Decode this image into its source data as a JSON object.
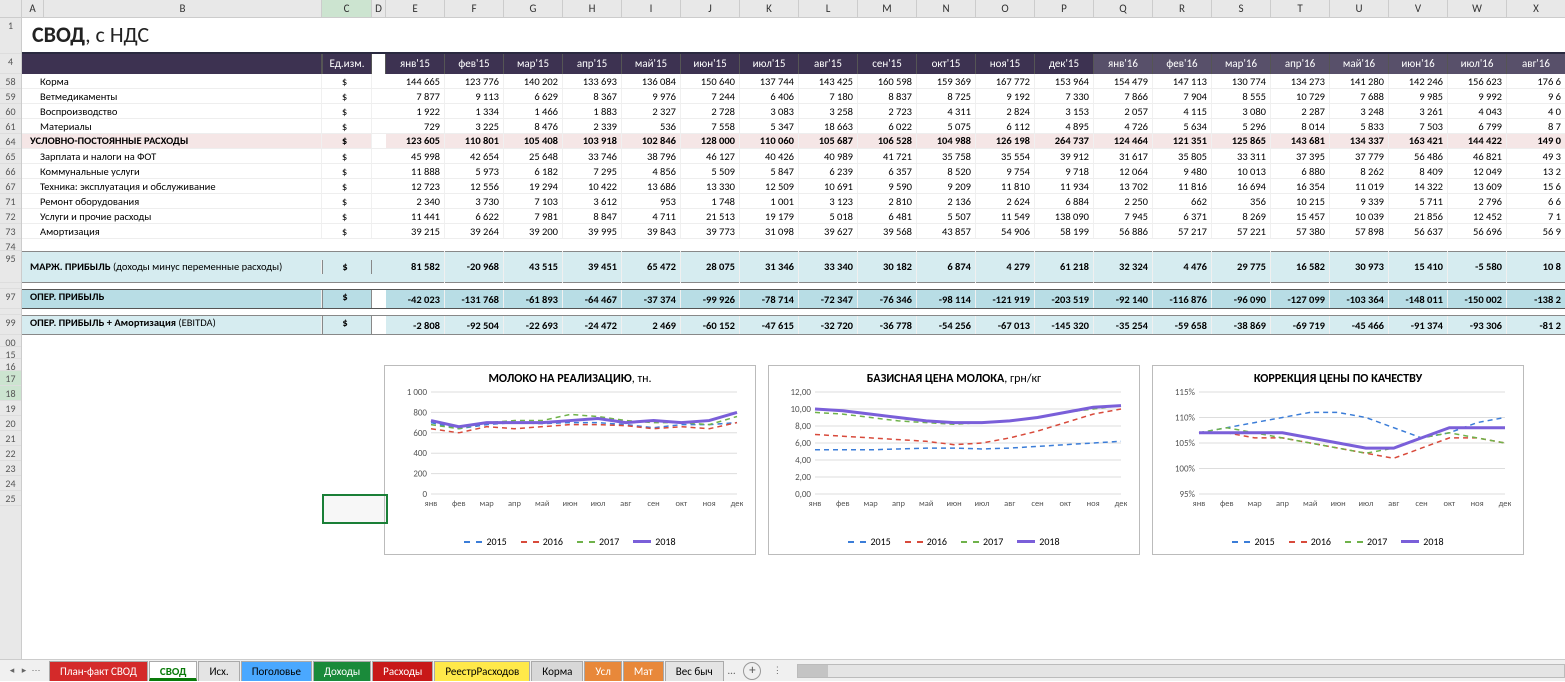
{
  "title": {
    "main": "СВОД",
    "sub": ", с НДС"
  },
  "columns_letters": [
    "A",
    "B",
    "C",
    "D",
    "E",
    "F",
    "G",
    "H",
    "I",
    "J",
    "K",
    "L",
    "M",
    "N",
    "O",
    "P",
    "Q",
    "R",
    "S",
    "T",
    "U",
    "V",
    "W",
    "X"
  ],
  "row_numbers": [
    "1",
    "4",
    "58",
    "59",
    "60",
    "61",
    "64",
    "65",
    "66",
    "67",
    "71",
    "72",
    "73",
    "74",
    "95",
    "97",
    "99",
    "00",
    "15",
    "16",
    "17",
    "18",
    "19",
    "20",
    "21",
    "22",
    "23",
    "24",
    "25"
  ],
  "selected_row_idx": [
    21,
    22
  ],
  "units_header": "Ед.изм.",
  "months": [
    "янв'15",
    "фев'15",
    "мар'15",
    "апр'15",
    "май'15",
    "июн'15",
    "июл'15",
    "авг'15",
    "сен'15",
    "окт'15",
    "ноя'15",
    "дек'15",
    "янв'16",
    "фев'16",
    "мар'16",
    "апр'16",
    "май'16",
    "июн'16",
    "июл'16",
    "авг'16"
  ],
  "rows": [
    {
      "label": "Корма",
      "unit": "$",
      "vals": [
        "144 665",
        "123 776",
        "140 202",
        "133 693",
        "136 084",
        "150 640",
        "137 744",
        "143 425",
        "160 598",
        "159 369",
        "167 772",
        "153 964",
        "154 479",
        "147 113",
        "130 774",
        "134 273",
        "141 280",
        "142 246",
        "156 623",
        "176 6"
      ]
    },
    {
      "label": "Ветмедикаменты",
      "unit": "$",
      "vals": [
        "7 877",
        "9 113",
        "6 629",
        "8 367",
        "9 976",
        "7 244",
        "6 406",
        "7 180",
        "8 837",
        "8 725",
        "9 192",
        "7 330",
        "7 866",
        "7 904",
        "8 555",
        "10 729",
        "7 688",
        "9 985",
        "9 992",
        "9 6"
      ]
    },
    {
      "label": "Воспроизводство",
      "unit": "$",
      "vals": [
        "1 922",
        "1 334",
        "1 466",
        "1 883",
        "2 327",
        "2 728",
        "3 083",
        "3 258",
        "2 723",
        "4 311",
        "2 824",
        "3 153",
        "2 057",
        "4 115",
        "3 080",
        "2 287",
        "3 248",
        "3 261",
        "4 043",
        "4 0"
      ]
    },
    {
      "label": "Материалы",
      "unit": "$",
      "vals": [
        "729",
        "3 225",
        "8 476",
        "2 339",
        "536",
        "7 558",
        "5 347",
        "18 663",
        "6 022",
        "5 075",
        "6 112",
        "4 895",
        "4 726",
        "5 634",
        "5 296",
        "8 014",
        "5 833",
        "7 503",
        "6 799",
        "8 7"
      ]
    },
    {
      "label": "УСЛОВНО-ПОСТОЯННЫЕ РАСХОДЫ",
      "unit": "$",
      "section": true,
      "vals": [
        "123 605",
        "110 801",
        "105 408",
        "103 918",
        "102 846",
        "128 000",
        "110 060",
        "105 687",
        "106 528",
        "104 988",
        "126 198",
        "264 737",
        "124 464",
        "121 351",
        "125 865",
        "143 681",
        "134 337",
        "163 421",
        "144 422",
        "149 0"
      ]
    },
    {
      "label": "Зарплата и налоги на ФОТ",
      "unit": "$",
      "vals": [
        "45 998",
        "42 654",
        "25 648",
        "33 746",
        "38 796",
        "46 127",
        "40 426",
        "40 989",
        "41 721",
        "35 758",
        "35 554",
        "39 912",
        "31 617",
        "35 805",
        "33 311",
        "37 395",
        "37 779",
        "56 486",
        "46 821",
        "49 3"
      ]
    },
    {
      "label": "Коммунальные услуги",
      "unit": "$",
      "vals": [
        "11 888",
        "5 973",
        "6 182",
        "7 295",
        "4 856",
        "5 509",
        "5 847",
        "6 239",
        "6 357",
        "8 520",
        "9 754",
        "9 718",
        "12 064",
        "9 480",
        "10 013",
        "6 880",
        "8 262",
        "8 409",
        "12 049",
        "13 2"
      ]
    },
    {
      "label": "Техника: эксплуатация и обслуживание",
      "unit": "$",
      "vals": [
        "12 723",
        "12 556",
        "19 294",
        "10 422",
        "13 686",
        "13 330",
        "12 509",
        "10 691",
        "9 590",
        "9 209",
        "11 810",
        "11 934",
        "13 702",
        "11 816",
        "16 694",
        "16 354",
        "11 019",
        "14 322",
        "13 609",
        "15 6"
      ]
    },
    {
      "label": "Ремонт оборудования",
      "unit": "$",
      "vals": [
        "2 340",
        "3 730",
        "7 103",
        "3 612",
        "953",
        "1 748",
        "1 001",
        "3 123",
        "2 810",
        "2 136",
        "2 624",
        "6 884",
        "2 250",
        "662",
        "356",
        "10 215",
        "9 339",
        "5 711",
        "2 796",
        "6 6"
      ]
    },
    {
      "label": "Услуги и прочие расходы",
      "unit": "$",
      "vals": [
        "11 441",
        "6 622",
        "7 981",
        "8 847",
        "4 711",
        "21 513",
        "19 179",
        "5 018",
        "6 481",
        "5 507",
        "11 549",
        "138 090",
        "7 945",
        "6 371",
        "8 269",
        "15 457",
        "10 039",
        "21 856",
        "12 452",
        "7 1"
      ]
    },
    {
      "label": "Амортизация",
      "unit": "$",
      "vals": [
        "39 215",
        "39 264",
        "39 200",
        "39 995",
        "39 843",
        "39 773",
        "31 098",
        "39 627",
        "39 568",
        "43 857",
        "54 906",
        "58 199",
        "56 886",
        "57 217",
        "57 221",
        "57 380",
        "57 898",
        "56 637",
        "56 696",
        "56 9"
      ]
    }
  ],
  "bottom_rows": [
    {
      "label": "МАРЖ. ПРИБЫЛЬ",
      "suffix": " (доходы минус переменные расходы)",
      "unit": "$",
      "cls": "blue",
      "tall": true,
      "vals": [
        "81 582",
        "-20 968",
        "43 515",
        "39 451",
        "65 472",
        "28 075",
        "31 346",
        "33 340",
        "30 182",
        "6 874",
        "4 279",
        "61 218",
        "32 324",
        "4 476",
        "29 775",
        "16 582",
        "30 973",
        "15 410",
        "-5 580",
        "10 8"
      ]
    },
    {
      "label": "ОПЕР. ПРИБЫЛЬ",
      "suffix": "",
      "unit": "$",
      "cls": "blue2",
      "vals": [
        "-42 023",
        "-131 768",
        "-61 893",
        "-64 467",
        "-37 374",
        "-99 926",
        "-78 714",
        "-72 347",
        "-76 346",
        "-98 114",
        "-121 919",
        "-203 519",
        "-92 140",
        "-116 876",
        "-96 090",
        "-127 099",
        "-103 364",
        "-148 011",
        "-150 002",
        "-138 2"
      ]
    },
    {
      "label": "ОПЕР. ПРИБЫЛЬ + Амортизация",
      "suffix": " (EBITDA)",
      "unit": "$",
      "cls": "blue",
      "vals": [
        "-2 808",
        "-92 504",
        "-22 693",
        "-24 472",
        "2 469",
        "-60 152",
        "-47 615",
        "-32 720",
        "-36 778",
        "-54 256",
        "-67 013",
        "-145 320",
        "-35 254",
        "-59 658",
        "-38 869",
        "-69 719",
        "-45 466",
        "-91 374",
        "-93 306",
        "-81 2"
      ]
    }
  ],
  "charts": [
    {
      "title_b": "МОЛОКО НА РЕАЛИЗАЦИЮ",
      "title_r": ", тн.",
      "ylabels": [
        "1 000",
        "800",
        "600",
        "400",
        "200",
        "0"
      ],
      "xlabels": [
        "янв",
        "фев",
        "мар",
        "апр",
        "май",
        "июн",
        "июл",
        "авг",
        "сен",
        "окт",
        "ноя",
        "дек"
      ]
    },
    {
      "title_b": "БАЗИСНАЯ ЦЕНА МОЛОКА",
      "title_r": ", грн/кг",
      "ylabels": [
        "12,00",
        "10,00",
        "8,00",
        "6,00",
        "4,00",
        "2,00",
        "0,00"
      ],
      "xlabels": [
        "янв",
        "фев",
        "мар",
        "апр",
        "май",
        "июн",
        "июл",
        "авг",
        "сен",
        "окт",
        "ноя",
        "дек"
      ]
    },
    {
      "title_b": "КОРРЕКЦИЯ ЦЕНЫ ПО КАЧЕСТВУ",
      "title_r": "",
      "ylabels": [
        "115%",
        "110%",
        "105%",
        "100%",
        "95%"
      ],
      "xlabels": [
        "янв",
        "фев",
        "мар",
        "апр",
        "май",
        "июн",
        "июл",
        "авг",
        "сен",
        "окт",
        "ноя",
        "дек"
      ]
    }
  ],
  "chart_data": [
    {
      "type": "line",
      "title": "МОЛОКО НА РЕАЛИЗАЦИЮ, тн.",
      "ylabel": "тн.",
      "ylim": [
        0,
        1000
      ],
      "categories": [
        "янв",
        "фев",
        "мар",
        "апр",
        "май",
        "июн",
        "июл",
        "авг",
        "сен",
        "окт",
        "ноя",
        "дек"
      ],
      "series": [
        {
          "name": "2015",
          "values": [
            700,
            640,
            680,
            700,
            690,
            700,
            700,
            680,
            650,
            680,
            680,
            700
          ]
        },
        {
          "name": "2016",
          "values": [
            640,
            600,
            660,
            640,
            660,
            680,
            680,
            670,
            640,
            660,
            640,
            700
          ]
        },
        {
          "name": "2017",
          "values": [
            680,
            640,
            700,
            720,
            720,
            780,
            760,
            720,
            700,
            700,
            680,
            760
          ]
        },
        {
          "name": "2018",
          "values": [
            720,
            660,
            700,
            700,
            700,
            720,
            740,
            700,
            720,
            700,
            720,
            800
          ]
        }
      ]
    },
    {
      "type": "line",
      "title": "БАЗИСНАЯ ЦЕНА МОЛОКА, грн/кг",
      "ylabel": "грн/кг",
      "ylim": [
        0,
        12
      ],
      "categories": [
        "янв",
        "фев",
        "мар",
        "апр",
        "май",
        "июн",
        "июл",
        "авг",
        "сен",
        "окт",
        "ноя",
        "дек"
      ],
      "series": [
        {
          "name": "2015",
          "values": [
            5.2,
            5.2,
            5.2,
            5.3,
            5.4,
            5.4,
            5.3,
            5.4,
            5.6,
            5.8,
            6.0,
            6.2
          ]
        },
        {
          "name": "2016",
          "values": [
            7.0,
            6.8,
            6.6,
            6.4,
            6.2,
            5.8,
            6.0,
            6.6,
            7.4,
            8.4,
            9.4,
            10.0
          ]
        },
        {
          "name": "2017",
          "values": [
            9.6,
            9.4,
            9.0,
            8.6,
            8.4,
            8.2,
            8.4,
            8.6,
            9.0,
            9.6,
            10.0,
            10.4
          ]
        },
        {
          "name": "2018",
          "values": [
            10.0,
            9.8,
            9.4,
            9.0,
            8.6,
            8.4,
            8.4,
            8.6,
            9.0,
            9.6,
            10.2,
            10.4
          ]
        }
      ]
    },
    {
      "type": "line",
      "title": "КОРРЕКЦИЯ ЦЕНЫ ПО КАЧЕСТВУ",
      "ylabel": "%",
      "ylim": [
        95,
        115
      ],
      "categories": [
        "янв",
        "фев",
        "мар",
        "апр",
        "май",
        "июн",
        "июл",
        "авг",
        "сен",
        "окт",
        "ноя",
        "дек"
      ],
      "series": [
        {
          "name": "2015",
          "values": [
            107,
            108,
            109,
            110,
            111,
            111,
            110,
            108,
            106,
            107,
            109,
            110
          ]
        },
        {
          "name": "2016",
          "values": [
            107,
            107,
            106,
            106,
            105,
            104,
            103,
            102,
            104,
            106,
            106,
            105
          ]
        },
        {
          "name": "2017",
          "values": [
            107,
            108,
            107,
            106,
            105,
            104,
            103,
            104,
            106,
            107,
            106,
            105
          ]
        },
        {
          "name": "2018",
          "values": [
            107,
            107,
            107,
            107,
            106,
            105,
            104,
            104,
            106,
            108,
            108,
            108
          ]
        }
      ]
    }
  ],
  "legend": [
    "2015",
    "2016",
    "2017",
    "2018"
  ],
  "legend_colors": [
    "#3b7dd8",
    "#d84a3b",
    "#6fb24a",
    "#7a5fd9"
  ],
  "tabs": [
    {
      "label": "План-факт СВОД",
      "cls": "tab-red"
    },
    {
      "label": "СВОД",
      "cls": "tab-green active"
    },
    {
      "label": "Исх.",
      "cls": "tab-grey2"
    },
    {
      "label": "Поголовье",
      "cls": "tab-blue"
    },
    {
      "label": "Доходы",
      "cls": "tab-dgreen"
    },
    {
      "label": "Расходы",
      "cls": "tab-dred"
    },
    {
      "label": "РеестрРасходов",
      "cls": "tab-yellow"
    },
    {
      "label": "Корма",
      "cls": "tab-grey"
    },
    {
      "label": "Усл",
      "cls": "tab-orange"
    },
    {
      "label": "Мат",
      "cls": "tab-orange"
    },
    {
      "label": "Вес быч",
      "cls": "tab-grey2"
    }
  ],
  "overflow_label": "…"
}
